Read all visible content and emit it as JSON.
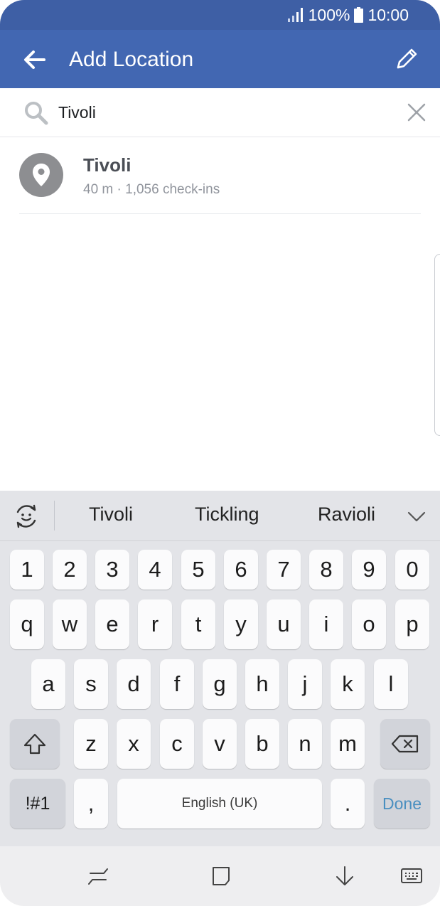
{
  "status_bar": {
    "battery": "100%",
    "time": "10:00"
  },
  "header": {
    "title": "Add Location"
  },
  "search": {
    "value": "Tivoli"
  },
  "results": [
    {
      "name": "Tivoli",
      "meta": "40 m · 1,056 check-ins"
    }
  ],
  "keyboard": {
    "suggestions": [
      "Tivoli",
      "Tickling",
      "Ravioli"
    ],
    "rows": {
      "numbers": [
        "1",
        "2",
        "3",
        "4",
        "5",
        "6",
        "7",
        "8",
        "9",
        "0"
      ],
      "row1": [
        "q",
        "w",
        "e",
        "r",
        "t",
        "y",
        "u",
        "i",
        "o",
        "p"
      ],
      "row2": [
        "a",
        "s",
        "d",
        "f",
        "g",
        "h",
        "j",
        "k",
        "l"
      ],
      "row3": [
        "z",
        "x",
        "c",
        "v",
        "b",
        "n",
        "m"
      ]
    },
    "symbols_label": "!#1",
    "comma_label": ",",
    "space_label": "English (UK)",
    "period_label": ".",
    "done_label": "Done"
  },
  "icons": {
    "back": "back-arrow-icon",
    "edit": "pencil-icon",
    "search": "search-icon",
    "clear": "close-icon",
    "place": "location-pin-icon",
    "emoji": "emoji-refresh-icon",
    "collapse": "chevron-down-icon",
    "shift": "shift-icon",
    "backspace": "backspace-icon",
    "nav_recent": "recent-apps-icon",
    "nav_home": "home-icon",
    "nav_back": "hide-keyboard-icon",
    "nav_keyboard": "keyboard-icon"
  },
  "colors": {
    "status_bar": "#3e5fa5",
    "app_bar": "#4267b2",
    "done_accent": "#4a8fc0"
  }
}
